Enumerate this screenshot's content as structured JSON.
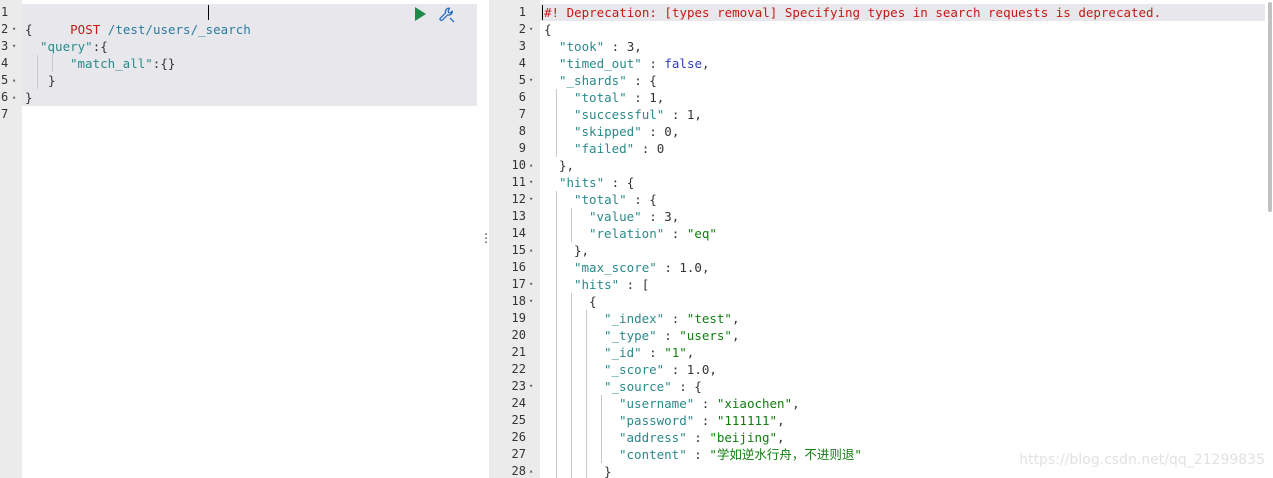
{
  "request": {
    "method": "POST",
    "url": "/test/users/_search",
    "lines": [
      {
        "n": "1",
        "fold": ""
      },
      {
        "n": "2",
        "fold": "down"
      },
      {
        "n": "3",
        "fold": "down"
      },
      {
        "n": "4",
        "fold": ""
      },
      {
        "n": "5",
        "fold": "up"
      },
      {
        "n": "6",
        "fold": "up"
      },
      {
        "n": "7",
        "fold": ""
      }
    ],
    "body": {
      "open_brace": "{",
      "query_key": "\"query\"",
      "query_open": ":{",
      "match_all_key": "\"match_all\"",
      "match_all_val": ":{}",
      "inner_close": "}",
      "outer_close": "}"
    }
  },
  "toolbar": {
    "run_icon": "play-icon",
    "settings_icon": "wrench-icon"
  },
  "divider": {
    "dots": "⋮"
  },
  "response": {
    "warning": "#! Deprecation: [types removal] Specifying types in search requests is deprecated.",
    "lines": [
      {
        "n": "1",
        "fold": "",
        "indent": 0,
        "parts": [
          {
            "c": "m",
            "t": "#! Deprecation: [types removal] Specifying types in search requests is deprecated."
          }
        ]
      },
      {
        "n": "2",
        "fold": "down",
        "indent": 0,
        "parts": [
          {
            "c": "n",
            "t": "{"
          }
        ]
      },
      {
        "n": "3",
        "fold": "",
        "indent": 1,
        "parts": [
          {
            "c": "k",
            "t": "\"took\""
          },
          {
            "c": "n",
            "t": " : 3,"
          }
        ]
      },
      {
        "n": "4",
        "fold": "",
        "indent": 1,
        "parts": [
          {
            "c": "k",
            "t": "\"timed_out\""
          },
          {
            "c": "n",
            "t": " : "
          },
          {
            "c": "b",
            "t": "false"
          },
          {
            "c": "n",
            "t": ","
          }
        ]
      },
      {
        "n": "5",
        "fold": "down",
        "indent": 1,
        "parts": [
          {
            "c": "k",
            "t": "\"_shards\""
          },
          {
            "c": "n",
            "t": " : {"
          }
        ]
      },
      {
        "n": "6",
        "fold": "",
        "indent": 2,
        "parts": [
          {
            "c": "k",
            "t": "\"total\""
          },
          {
            "c": "n",
            "t": " : 1,"
          }
        ]
      },
      {
        "n": "7",
        "fold": "",
        "indent": 2,
        "parts": [
          {
            "c": "k",
            "t": "\"successful\""
          },
          {
            "c": "n",
            "t": " : 1,"
          }
        ]
      },
      {
        "n": "8",
        "fold": "",
        "indent": 2,
        "parts": [
          {
            "c": "k",
            "t": "\"skipped\""
          },
          {
            "c": "n",
            "t": " : 0,"
          }
        ]
      },
      {
        "n": "9",
        "fold": "",
        "indent": 2,
        "parts": [
          {
            "c": "k",
            "t": "\"failed\""
          },
          {
            "c": "n",
            "t": " : 0"
          }
        ]
      },
      {
        "n": "10",
        "fold": "up",
        "indent": 1,
        "parts": [
          {
            "c": "n",
            "t": "},"
          }
        ]
      },
      {
        "n": "11",
        "fold": "down",
        "indent": 1,
        "parts": [
          {
            "c": "k",
            "t": "\"hits\""
          },
          {
            "c": "n",
            "t": " : {"
          }
        ]
      },
      {
        "n": "12",
        "fold": "down",
        "indent": 2,
        "parts": [
          {
            "c": "k",
            "t": "\"total\""
          },
          {
            "c": "n",
            "t": " : {"
          }
        ]
      },
      {
        "n": "13",
        "fold": "",
        "indent": 3,
        "parts": [
          {
            "c": "k",
            "t": "\"value\""
          },
          {
            "c": "n",
            "t": " : 3,"
          }
        ]
      },
      {
        "n": "14",
        "fold": "",
        "indent": 3,
        "parts": [
          {
            "c": "k",
            "t": "\"relation\""
          },
          {
            "c": "n",
            "t": " : "
          },
          {
            "c": "s",
            "t": "\"eq\""
          }
        ]
      },
      {
        "n": "15",
        "fold": "up",
        "indent": 2,
        "parts": [
          {
            "c": "n",
            "t": "},"
          }
        ]
      },
      {
        "n": "16",
        "fold": "",
        "indent": 2,
        "parts": [
          {
            "c": "k",
            "t": "\"max_score\""
          },
          {
            "c": "n",
            "t": " : 1.0,"
          }
        ]
      },
      {
        "n": "17",
        "fold": "down",
        "indent": 2,
        "parts": [
          {
            "c": "k",
            "t": "\"hits\""
          },
          {
            "c": "n",
            "t": " : ["
          }
        ]
      },
      {
        "n": "18",
        "fold": "down",
        "indent": 3,
        "parts": [
          {
            "c": "n",
            "t": "{"
          }
        ]
      },
      {
        "n": "19",
        "fold": "",
        "indent": 4,
        "parts": [
          {
            "c": "k",
            "t": "\"_index\""
          },
          {
            "c": "n",
            "t": " : "
          },
          {
            "c": "s",
            "t": "\"test\""
          },
          {
            "c": "n",
            "t": ","
          }
        ]
      },
      {
        "n": "20",
        "fold": "",
        "indent": 4,
        "parts": [
          {
            "c": "k",
            "t": "\"_type\""
          },
          {
            "c": "n",
            "t": " : "
          },
          {
            "c": "s",
            "t": "\"users\""
          },
          {
            "c": "n",
            "t": ","
          }
        ]
      },
      {
        "n": "21",
        "fold": "",
        "indent": 4,
        "parts": [
          {
            "c": "k",
            "t": "\"_id\""
          },
          {
            "c": "n",
            "t": " : "
          },
          {
            "c": "s",
            "t": "\"1\""
          },
          {
            "c": "n",
            "t": ","
          }
        ]
      },
      {
        "n": "22",
        "fold": "",
        "indent": 4,
        "parts": [
          {
            "c": "k",
            "t": "\"_score\""
          },
          {
            "c": "n",
            "t": " : 1.0,"
          }
        ]
      },
      {
        "n": "23",
        "fold": "down",
        "indent": 4,
        "parts": [
          {
            "c": "k",
            "t": "\"_source\""
          },
          {
            "c": "n",
            "t": " : {"
          }
        ]
      },
      {
        "n": "24",
        "fold": "",
        "indent": 5,
        "parts": [
          {
            "c": "k",
            "t": "\"username\""
          },
          {
            "c": "n",
            "t": " : "
          },
          {
            "c": "s",
            "t": "\"xiaochen\""
          },
          {
            "c": "n",
            "t": ","
          }
        ]
      },
      {
        "n": "25",
        "fold": "",
        "indent": 5,
        "parts": [
          {
            "c": "k",
            "t": "\"password\""
          },
          {
            "c": "n",
            "t": " : "
          },
          {
            "c": "s",
            "t": "\"111111\""
          },
          {
            "c": "n",
            "t": ","
          }
        ]
      },
      {
        "n": "26",
        "fold": "",
        "indent": 5,
        "parts": [
          {
            "c": "k",
            "t": "\"address\""
          },
          {
            "c": "n",
            "t": " : "
          },
          {
            "c": "s",
            "t": "\"beijing\""
          },
          {
            "c": "n",
            "t": ","
          }
        ]
      },
      {
        "n": "27",
        "fold": "",
        "indent": 5,
        "parts": [
          {
            "c": "k",
            "t": "\"content\""
          },
          {
            "c": "n",
            "t": " : "
          },
          {
            "c": "s",
            "t": "\"学如逆水行舟，不进则退\""
          }
        ]
      },
      {
        "n": "28",
        "fold": "up",
        "indent": 4,
        "parts": [
          {
            "c": "n",
            "t": "}"
          }
        ]
      }
    ]
  },
  "watermark": "https://blog.csdn.net/qq_21299835"
}
